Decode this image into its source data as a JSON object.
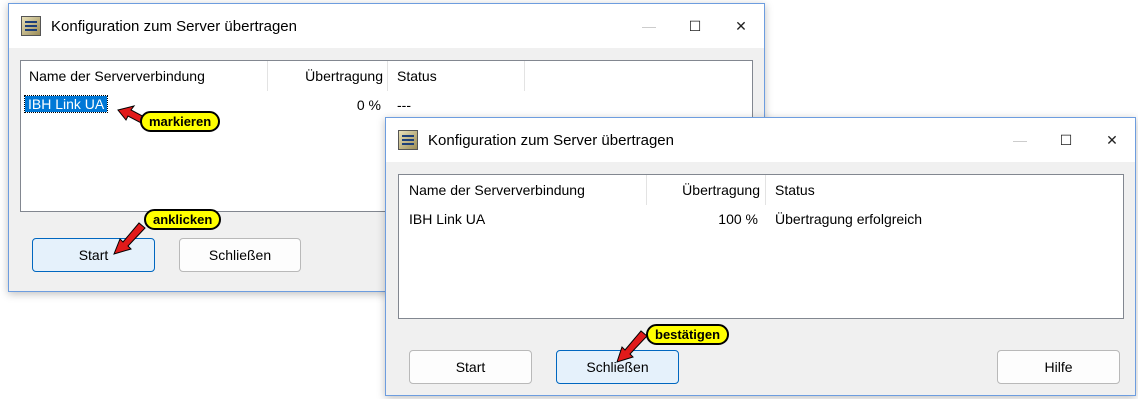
{
  "colors": {
    "selection": "#0078d7",
    "callout": "#ffff00",
    "arrow": "#e11a1a",
    "window_border": "#6d9ddf"
  },
  "icons": {
    "app": "configuration-app-icon",
    "min": "minimize-icon",
    "max": "maximize-icon",
    "close": "close-icon"
  },
  "titlebar_glyphs": {
    "min": "—",
    "max": "☐",
    "close": "✕"
  },
  "window1": {
    "title": "Konfiguration zum Server übertragen",
    "columns": [
      "Name der Serververbindung",
      "Übertragung",
      "Status"
    ],
    "rows": [
      {
        "name": "IBH Link UA",
        "transfer": "0 %",
        "status": "---",
        "selected": true
      }
    ],
    "buttons": {
      "start": "Start",
      "close": "Schließen"
    }
  },
  "window2": {
    "title": "Konfiguration zum Server übertragen",
    "columns": [
      "Name der Serververbindung",
      "Übertragung",
      "Status"
    ],
    "rows": [
      {
        "name": "IBH Link UA",
        "transfer": "100 %",
        "status": "Übertragung erfolgreich"
      }
    ],
    "buttons": {
      "start": "Start",
      "close": "Schließen",
      "help": "Hilfe"
    }
  },
  "callouts": {
    "mark": "markieren",
    "click": "anklicken",
    "confirm": "bestätigen"
  }
}
